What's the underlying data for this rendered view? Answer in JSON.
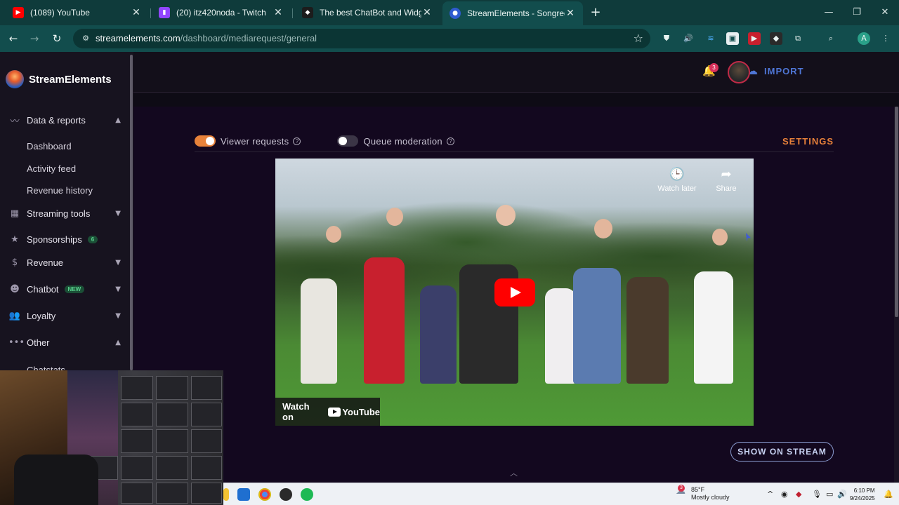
{
  "browser": {
    "tabs": [
      {
        "title": "(1089) YouTube",
        "icon": "youtube-icon",
        "color": "#ff0000"
      },
      {
        "title": "(20) itz420noda - Twitch",
        "icon": "twitch-icon",
        "color": "#9146ff"
      },
      {
        "title": "The best ChatBot and Widgets",
        "icon": "streamelements-icon",
        "color": "#222222"
      },
      {
        "title": "StreamElements - Songrequest",
        "icon": "streamelements-icon",
        "color": "#2f5bd0"
      }
    ],
    "url_host": "streamelements.com",
    "url_path": "/dashboard/mediarequest/general",
    "profile_initial": "A"
  },
  "header": {
    "import_label": "IMPORT",
    "notification_count": "3"
  },
  "sidebar": {
    "brand": "StreamElements",
    "groups": [
      {
        "label": "Data & reports",
        "icon": "chart-icon",
        "chevron": "^"
      },
      {
        "label": "Streaming tools",
        "icon": "layout-icon",
        "chevron": "v"
      },
      {
        "label": "Sponsorships",
        "icon": "star-icon",
        "badge": "6"
      },
      {
        "label": "Revenue",
        "icon": "dollar-icon",
        "chevron": "v"
      },
      {
        "label": "Chatbot",
        "icon": "robot-icon",
        "badge": "NEW",
        "chevron": "v"
      },
      {
        "label": "Loyalty",
        "icon": "people-icon",
        "chevron": "v"
      },
      {
        "label": "Other",
        "icon": "dots-icon",
        "chevron": "^"
      }
    ],
    "data_reports_items": [
      "Dashboard",
      "Activity feed",
      "Revenue history"
    ],
    "other_items": [
      "Chatstats"
    ]
  },
  "media": {
    "viewer_requests_label": "Viewer requests",
    "viewer_requests_on": true,
    "queue_moderation_label": "Queue moderation",
    "queue_moderation_on": false,
    "settings_label": "SETTINGS",
    "watch_later_label": "Watch later",
    "share_label": "Share",
    "watch_on_label": "Watch on",
    "youtube_label": "YouTube",
    "show_on_stream_label": "SHOW ON STREAM"
  },
  "taskbar": {
    "weather_temp": "85°F",
    "weather_desc": "Mostly cloudy",
    "weather_badge": "3",
    "time": "6:10 PM",
    "date": "9/24/2025"
  },
  "colors": {
    "accent_orange": "#e6803a",
    "import_blue": "#4f76d6",
    "chrome_teal": "#124d4d"
  }
}
